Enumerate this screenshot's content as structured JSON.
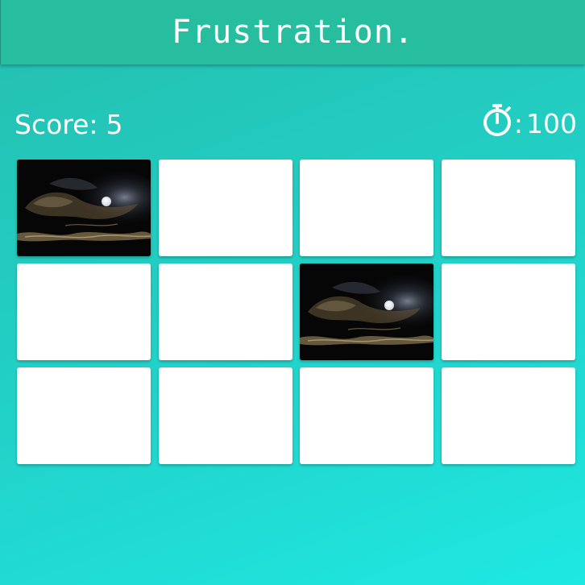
{
  "header": {
    "title": "Frustration."
  },
  "stats": {
    "score_label": "Score:",
    "score_value": "5",
    "timer_icon": "stopwatch-icon",
    "timer_separator": ":",
    "timer_value": "100"
  },
  "board": {
    "rows": 3,
    "columns": 4,
    "cards": [
      {
        "state": "revealed",
        "image": "moon-clouds"
      },
      {
        "state": "hidden"
      },
      {
        "state": "hidden"
      },
      {
        "state": "hidden"
      },
      {
        "state": "hidden"
      },
      {
        "state": "hidden"
      },
      {
        "state": "revealed",
        "image": "moon-clouds"
      },
      {
        "state": "hidden"
      },
      {
        "state": "hidden"
      },
      {
        "state": "hidden"
      },
      {
        "state": "hidden"
      },
      {
        "state": "hidden"
      }
    ]
  },
  "colors": {
    "header_bg": "#27bd9f",
    "background_start": "#24bfae",
    "background_end": "#1ee8e2",
    "card_back": "#ffffff"
  }
}
